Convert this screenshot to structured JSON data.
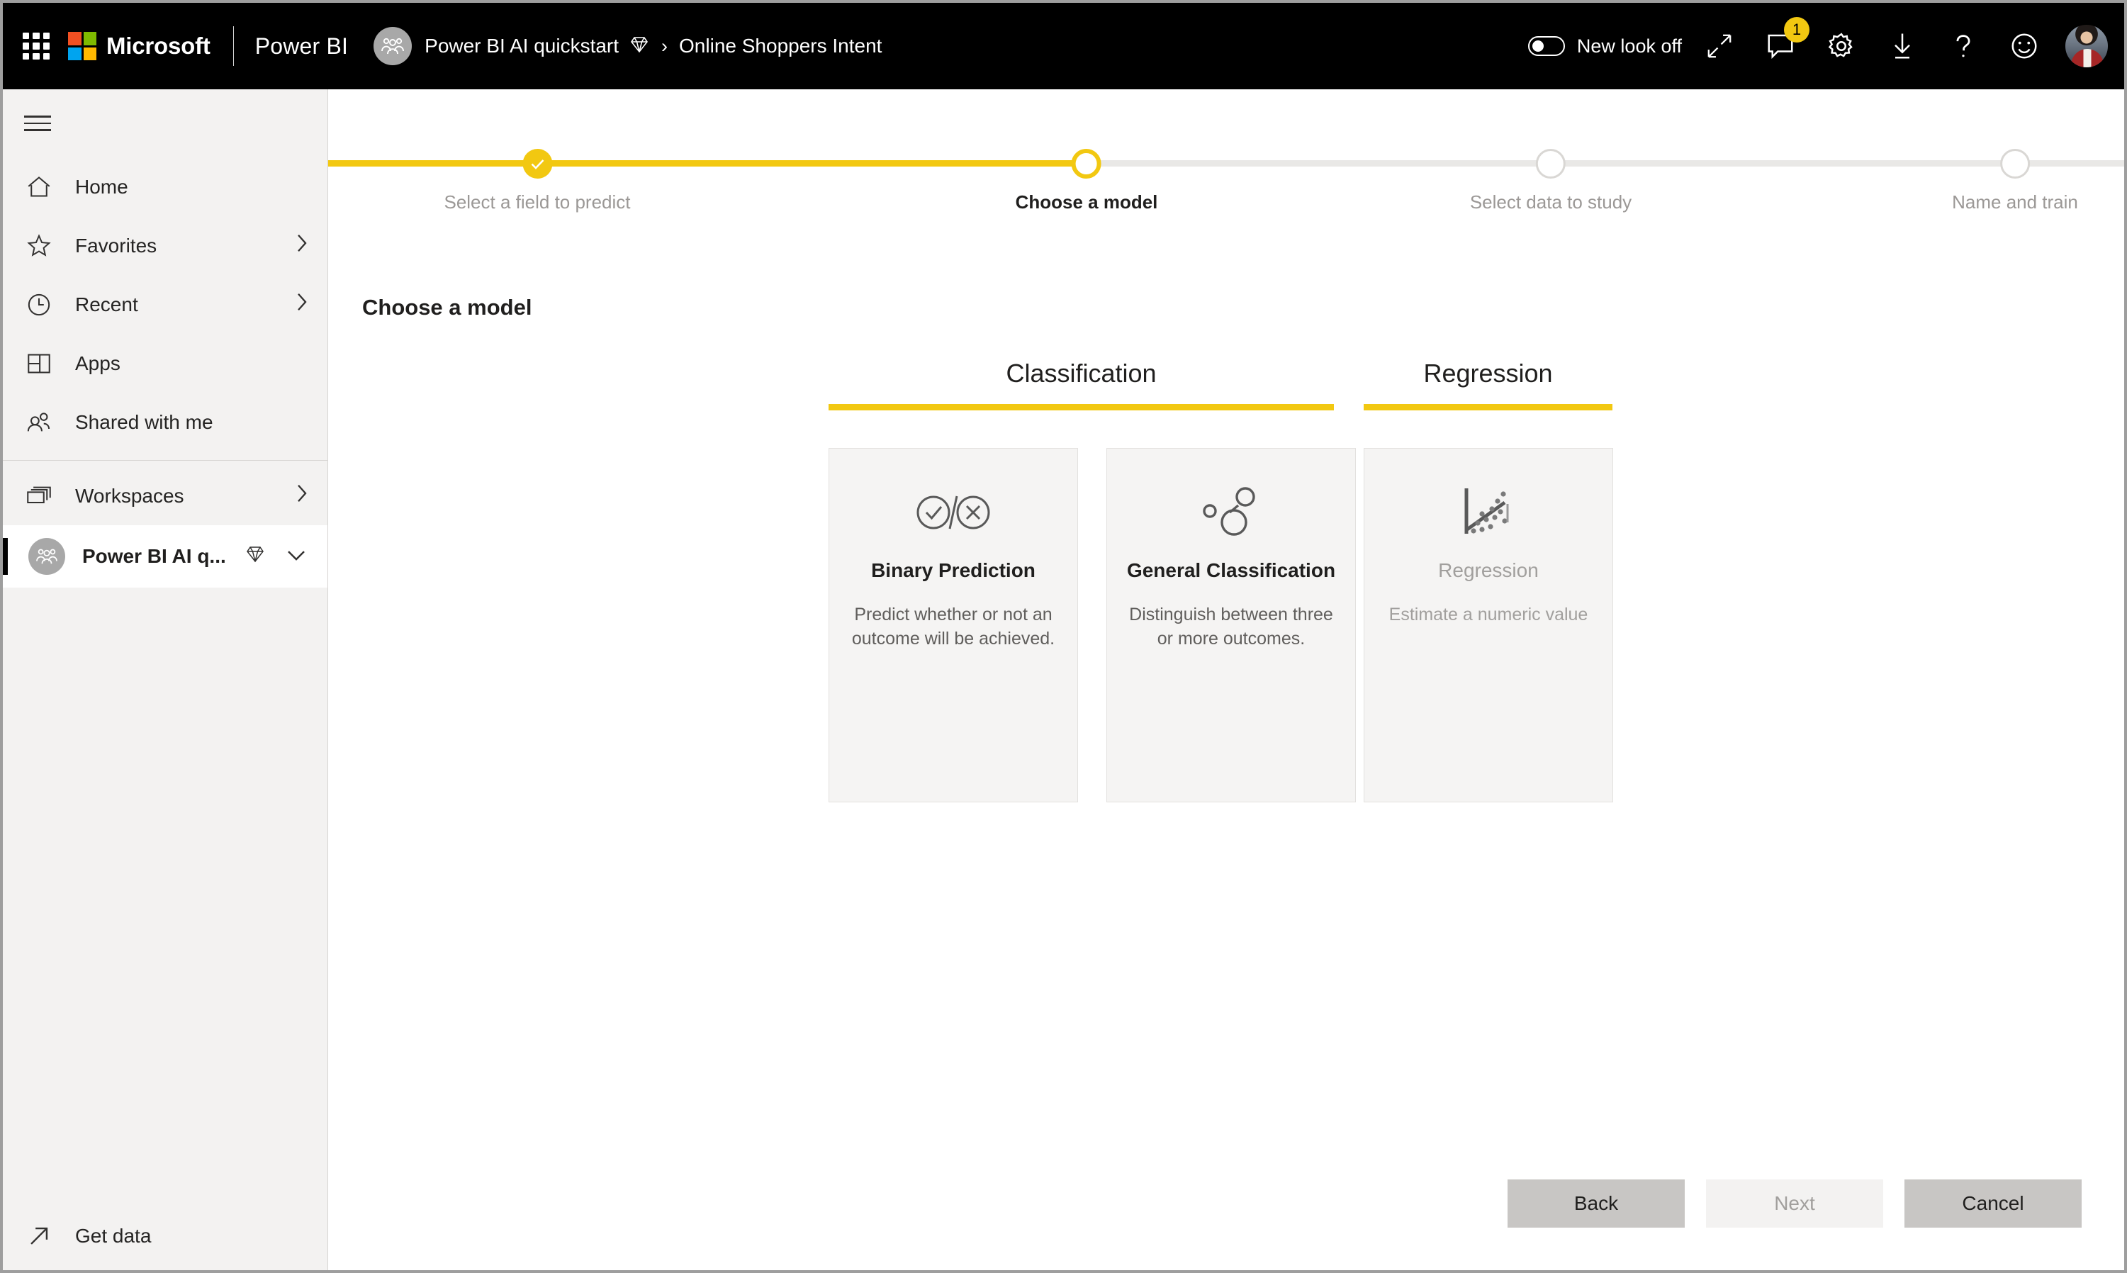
{
  "topbar": {
    "waffle_label": "app-launcher",
    "brand": "Microsoft",
    "product": "Power BI",
    "breadcrumb": {
      "workspace": "Power BI AI quickstart",
      "separator": "›",
      "current": "Online Shoppers Intent"
    },
    "new_look_toggle": {
      "label": "New look off",
      "state": "off"
    },
    "icons": [
      {
        "name": "expand-icon",
        "glyph": "↗"
      },
      {
        "name": "comments-icon",
        "badge": "1"
      },
      {
        "name": "settings-gear-icon"
      },
      {
        "name": "download-icon"
      },
      {
        "name": "help-icon",
        "glyph": "?"
      },
      {
        "name": "feedback-smiley-icon"
      }
    ],
    "avatar_label": "user-account-avatar"
  },
  "sidebar": {
    "menu_button": "navigation-menu",
    "items": [
      {
        "label": "Home",
        "icon": "home-icon",
        "chevron": false
      },
      {
        "label": "Favorites",
        "icon": "star-icon",
        "chevron": true
      },
      {
        "label": "Recent",
        "icon": "clock-icon",
        "chevron": true
      },
      {
        "label": "Apps",
        "icon": "apps-grid-icon",
        "chevron": false
      },
      {
        "label": "Shared with me",
        "icon": "people-icon",
        "chevron": false
      }
    ],
    "workspaces_label": "Workspaces",
    "selected_workspace": "Power BI AI q...",
    "get_data_label": "Get data"
  },
  "main": {
    "steps": [
      {
        "label": "Select a field to predict",
        "state": "done"
      },
      {
        "label": "Choose a model",
        "state": "active"
      },
      {
        "label": "Select data to study",
        "state": "todo"
      },
      {
        "label": "Name and train",
        "state": "todo"
      }
    ],
    "page_title": "Choose a model",
    "categories": [
      {
        "title": "Classification"
      },
      {
        "title": "Regression"
      }
    ],
    "model_cards": [
      {
        "title": "Binary Prediction",
        "description": "Predict whether or not an outcome will be achieved.",
        "icon": "binary-check-cross-icon",
        "enabled": true
      },
      {
        "title": "General Classification",
        "description": "Distinguish between three or more outcomes.",
        "icon": "cluster-bubbles-icon",
        "enabled": true
      },
      {
        "title": "Regression",
        "description": "Estimate a numeric value",
        "icon": "scatter-trendline-icon",
        "enabled": false
      }
    ],
    "buttons": {
      "back": "Back",
      "next": "Next",
      "cancel": "Cancel"
    }
  },
  "colors": {
    "accent_yellow": "#f2c811",
    "topbar_black": "#000000",
    "sidebar_gray": "#f3f2f1",
    "card_gray": "#f5f4f3"
  }
}
